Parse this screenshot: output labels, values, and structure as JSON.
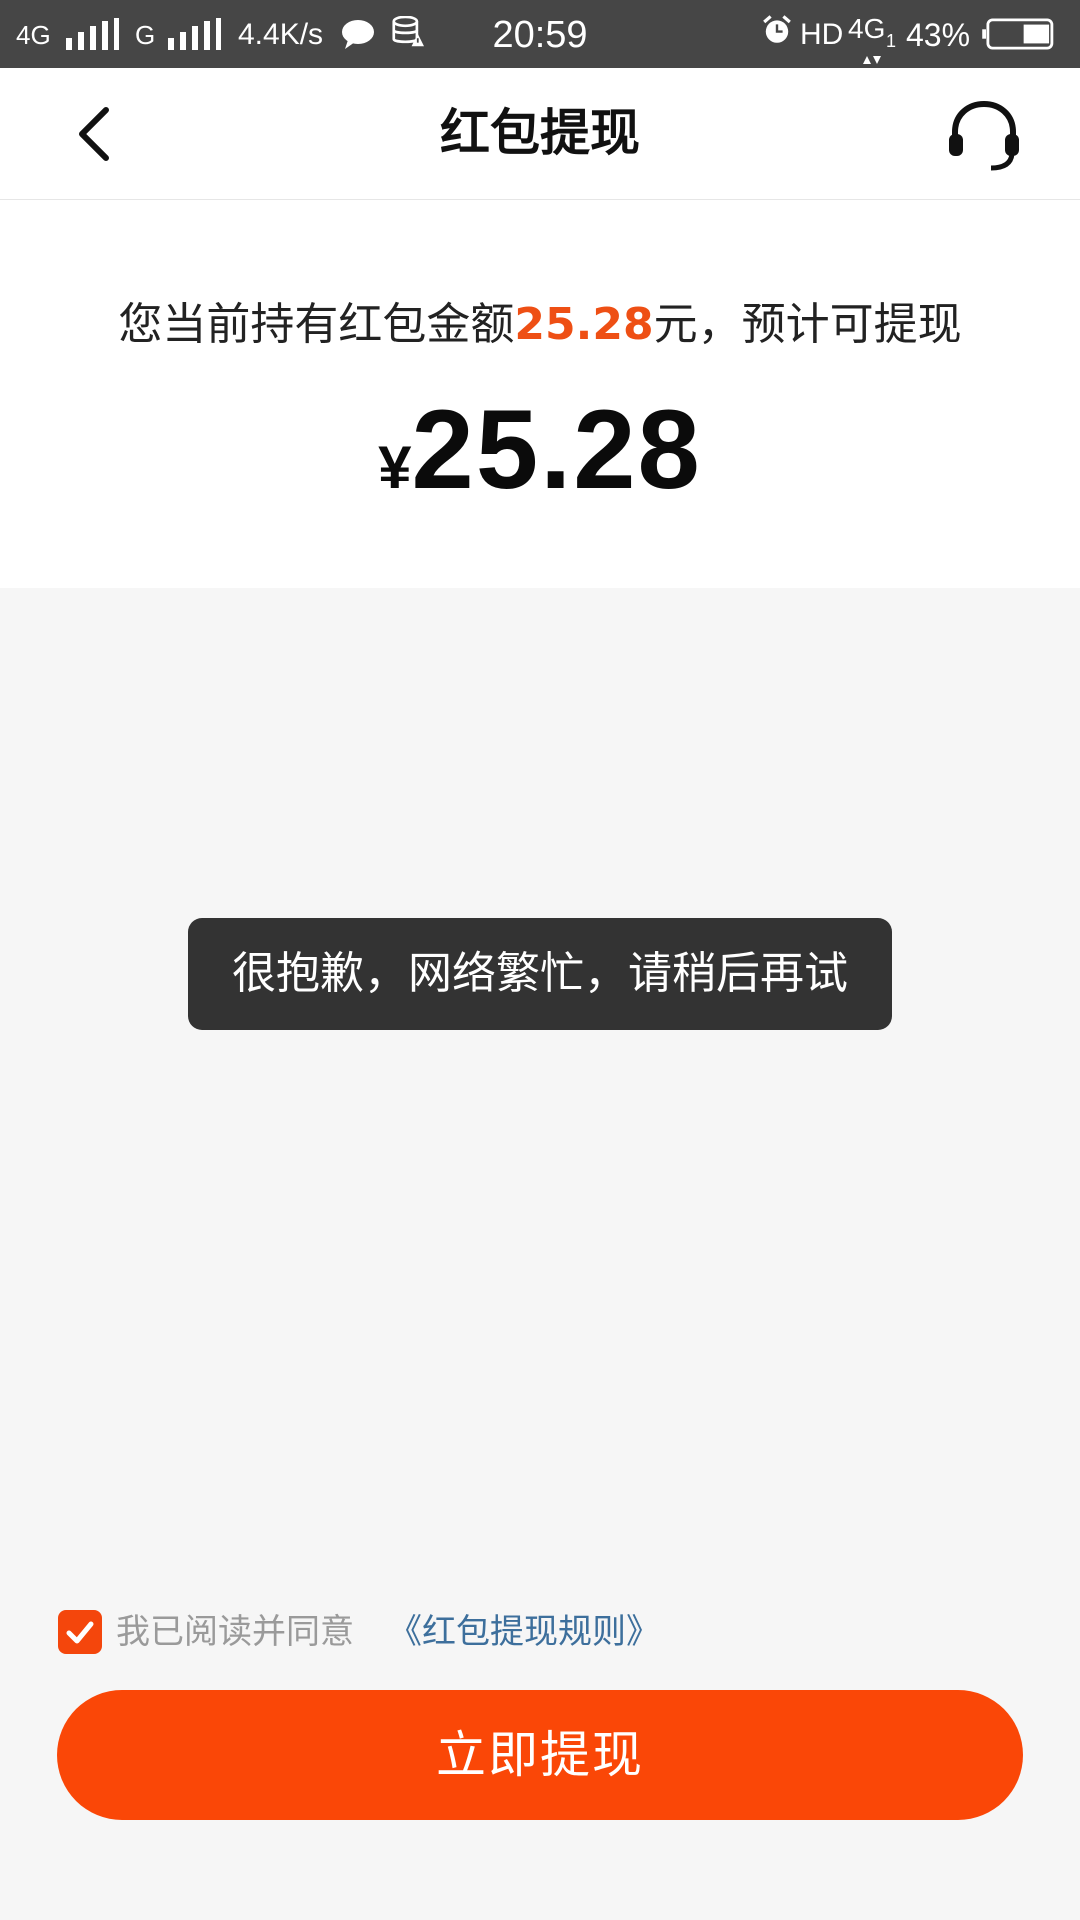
{
  "status_bar": {
    "net1": "4G",
    "net2": "G",
    "speed": "4.4K/s",
    "time": "20:59",
    "hd": "HD",
    "net3": "4G",
    "net3_sub": "1",
    "battery": "43%",
    "battery_level": 0.43
  },
  "header": {
    "title": "红包提现"
  },
  "balance": {
    "prefix": "您当前持有红包金额",
    "amount": "25.28",
    "suffix": "元，预计可提现",
    "currency": "¥",
    "withdrawable": "25.28"
  },
  "toast": {
    "message": "很抱歉，网络繁忙，请稍后再试"
  },
  "agreement": {
    "checked": true,
    "text": "我已阅读并同意",
    "link": "《红包提现规则》"
  },
  "actions": {
    "withdraw_label": "立即提现"
  },
  "colors": {
    "accent": "#fa4707",
    "amount_highlight": "#ee4f14",
    "link": "#3d6f9c",
    "toast_bg": "#333333"
  }
}
